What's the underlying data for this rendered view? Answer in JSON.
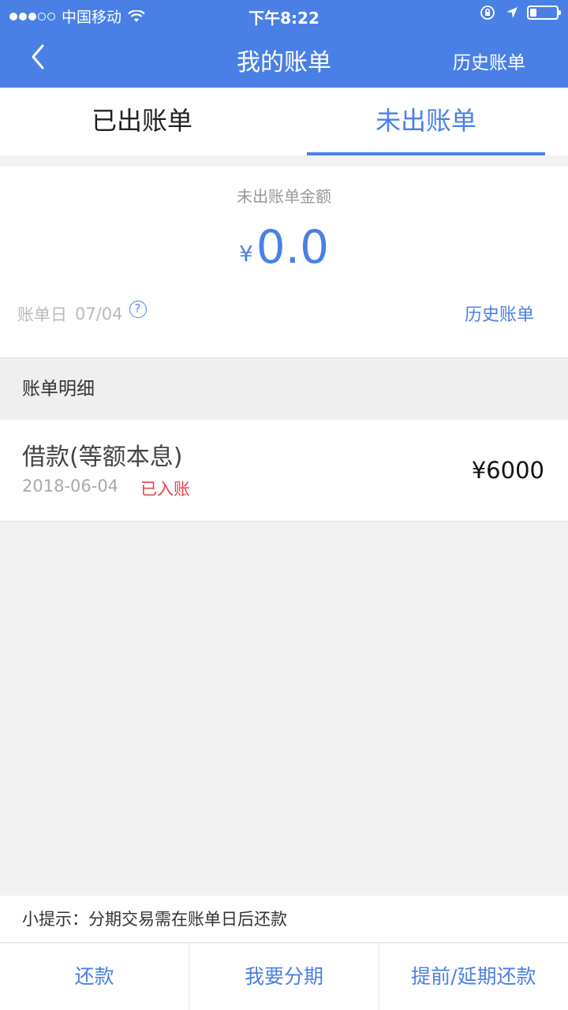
{
  "status_bar": {
    "carrier": "中国移动",
    "time": "下午8:22",
    "signal_filled": 3,
    "signal_total": 5,
    "battery_level": 0.25
  },
  "nav": {
    "title": "我的账单",
    "right_label": "历史账单",
    "back_icon": "chevron-left-icon"
  },
  "tabs": [
    {
      "label": "已出账单",
      "active": false
    },
    {
      "label": "未出账单",
      "active": true
    }
  ],
  "summary": {
    "label": "未出账单金额",
    "currency": "¥",
    "amount": "0.0",
    "bill_day_label": "账单日",
    "bill_day_value": "07/04",
    "help_icon_glyph": "?",
    "history_label": "历史账单"
  },
  "detail": {
    "header": "账单明细",
    "items": [
      {
        "title": "借款(等额本息)",
        "date": "2018-06-04",
        "status": "已入账",
        "amount": "¥6000"
      }
    ]
  },
  "tip": "小提示：分期交易需在账单日后还款",
  "bottom_actions": [
    "还款",
    "我要分期",
    "提前/延期还款"
  ],
  "colors": {
    "brand": "#4a80e6",
    "status_red": "#e0474c"
  }
}
